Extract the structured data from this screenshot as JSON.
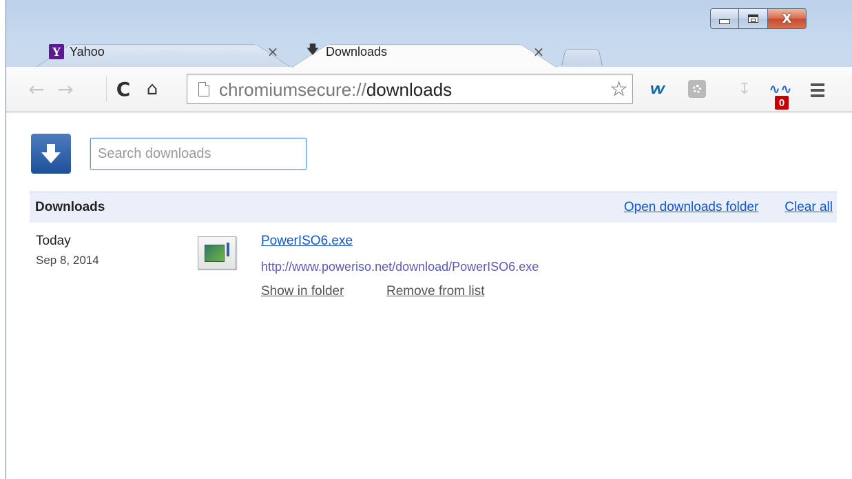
{
  "window": {
    "minimize_label": "",
    "maximize_label": "",
    "close_label": "X"
  },
  "tabs": [
    {
      "title": "Yahoo",
      "favicon": "Y",
      "close": "×"
    },
    {
      "title": "Downloads",
      "favicon": "download-arrow-icon",
      "close": "×"
    }
  ],
  "toolbar": {
    "url_scheme": "chromiumsecure://",
    "url_host": "downloads",
    "badge_count": "0"
  },
  "page": {
    "search_placeholder": "Search downloads",
    "header_title": "Downloads",
    "open_folder_label": "Open downloads folder",
    "clear_all_label": "Clear all"
  },
  "downloads": [
    {
      "date_relative": "Today",
      "date": "Sep 8, 2014",
      "file_name": "PowerISO6.exe",
      "url": "http://www.poweriso.net/download/PowerISO6.exe",
      "show_in_folder_label": "Show in folder",
      "remove_label": "Remove from list"
    }
  ],
  "colors": {
    "link": "#1155cc",
    "header_bg": "#ebeff9",
    "badge": "#c40000"
  }
}
